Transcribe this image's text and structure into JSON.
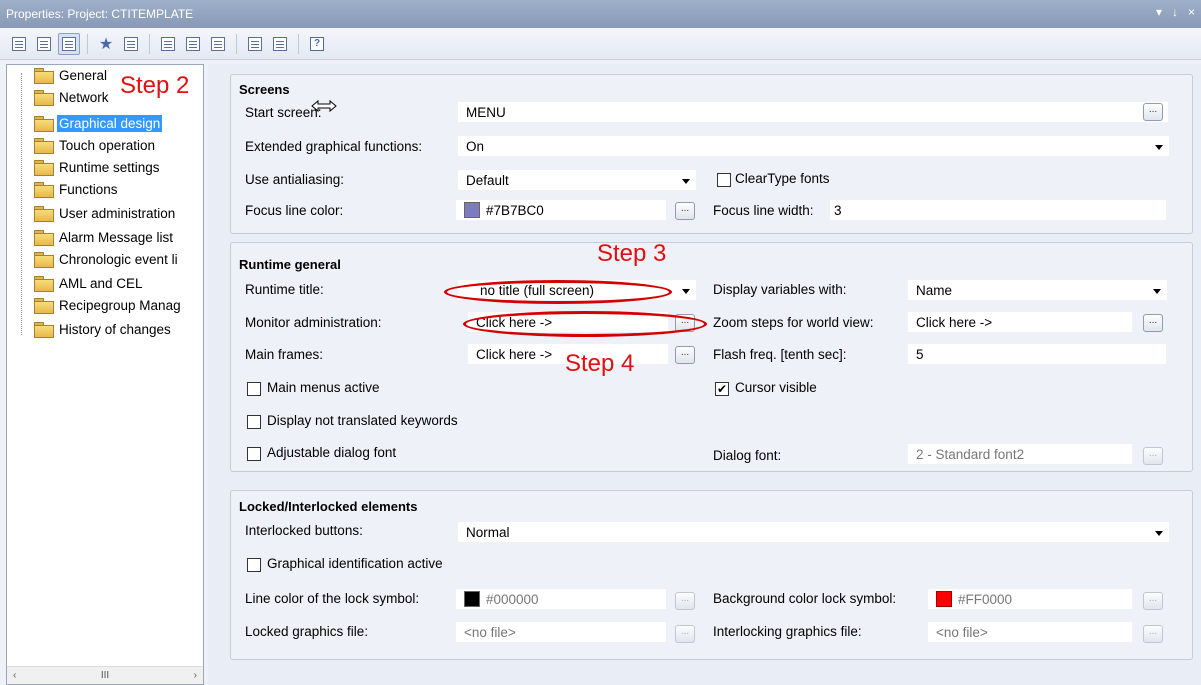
{
  "window": {
    "title": "Properties: Project: CTITEMPLATE",
    "controls": [
      "▾",
      "←",
      "×"
    ]
  },
  "toolbar": {
    "buttons": [
      "categorized-view",
      "alphabetic-view",
      "group-view",
      "favorites",
      "properties",
      "column-1",
      "column-2",
      "column-3",
      "expand",
      "collapse",
      "help"
    ]
  },
  "tree": {
    "items": [
      {
        "label": "General"
      },
      {
        "label": "Network"
      },
      {
        "label": "Graphical design",
        "selected": true
      },
      {
        "label": "Touch operation"
      },
      {
        "label": "Runtime settings"
      },
      {
        "label": "Functions"
      },
      {
        "label": "User administration"
      },
      {
        "label": "Alarm Message list"
      },
      {
        "label": "Chronologic event li"
      },
      {
        "label": "AML and CEL"
      },
      {
        "label": "Recipegroup Manag"
      },
      {
        "label": "History of changes"
      }
    ],
    "scroll_left": "‹",
    "scroll_thumb": "III",
    "scroll_right": "›"
  },
  "screens": {
    "title": "Screens",
    "start_screen_label": "Start screen:",
    "start_screen_value": "MENU",
    "ext_graph_label": "Extended graphical functions:",
    "ext_graph_value": "On",
    "antialias_label": "Use antialiasing:",
    "antialias_value": "Default",
    "cleartype_label": "ClearType fonts",
    "focus_color_label": "Focus line color:",
    "focus_color_value": "#7B7BC0",
    "focus_width_label": "Focus line width:",
    "focus_width_value": "3",
    "dots": "..."
  },
  "runtime": {
    "title": "Runtime general",
    "title_label": "Runtime title:",
    "title_value": "no title (full screen)",
    "display_vars_label": "Display variables with:",
    "display_vars_value": "Name",
    "monitor_label": "Monitor administration:",
    "monitor_value": "Click here ->",
    "zoom_label": "Zoom steps for world view:",
    "zoom_value": "Click here ->",
    "main_frames_label": "Main frames:",
    "main_frames_value": "Click here ->",
    "flash_label": "Flash freq. [tenth sec]:",
    "flash_value": "5",
    "main_menus_label": "Main menus active",
    "cursor_visible_label": "Cursor visible",
    "cursor_visible_check": "✔",
    "not_translated_label": "Display not translated keywords",
    "adjustable_font_label": "Adjustable dialog font",
    "dialog_font_label": "Dialog font:",
    "dialog_font_value": "2 - Standard font2"
  },
  "locked": {
    "title": "Locked/Interlocked elements",
    "interlocked_label": "Interlocked buttons:",
    "interlocked_value": "Normal",
    "graph_id_label": "Graphical identification active",
    "line_color_label": "Line color of the lock symbol:",
    "line_color_value": "#000000",
    "bg_color_label": "Background color lock symbol:",
    "bg_color_value": "#FF0000",
    "locked_file_label": "Locked graphics file:",
    "locked_file_value": "<no file>",
    "interlocking_file_label": "Interlocking graphics file:",
    "interlocking_file_value": "<no file>"
  },
  "annotations": {
    "step2": "Step 2",
    "step3": "Step 3",
    "step4": "Step 4"
  },
  "colors": {
    "accent_selected": "#3399ff",
    "focus_swatch": "#7B7BC0",
    "line_swatch": "#000000",
    "bg_swatch": "#FF0000",
    "annotation": "#e01010"
  }
}
